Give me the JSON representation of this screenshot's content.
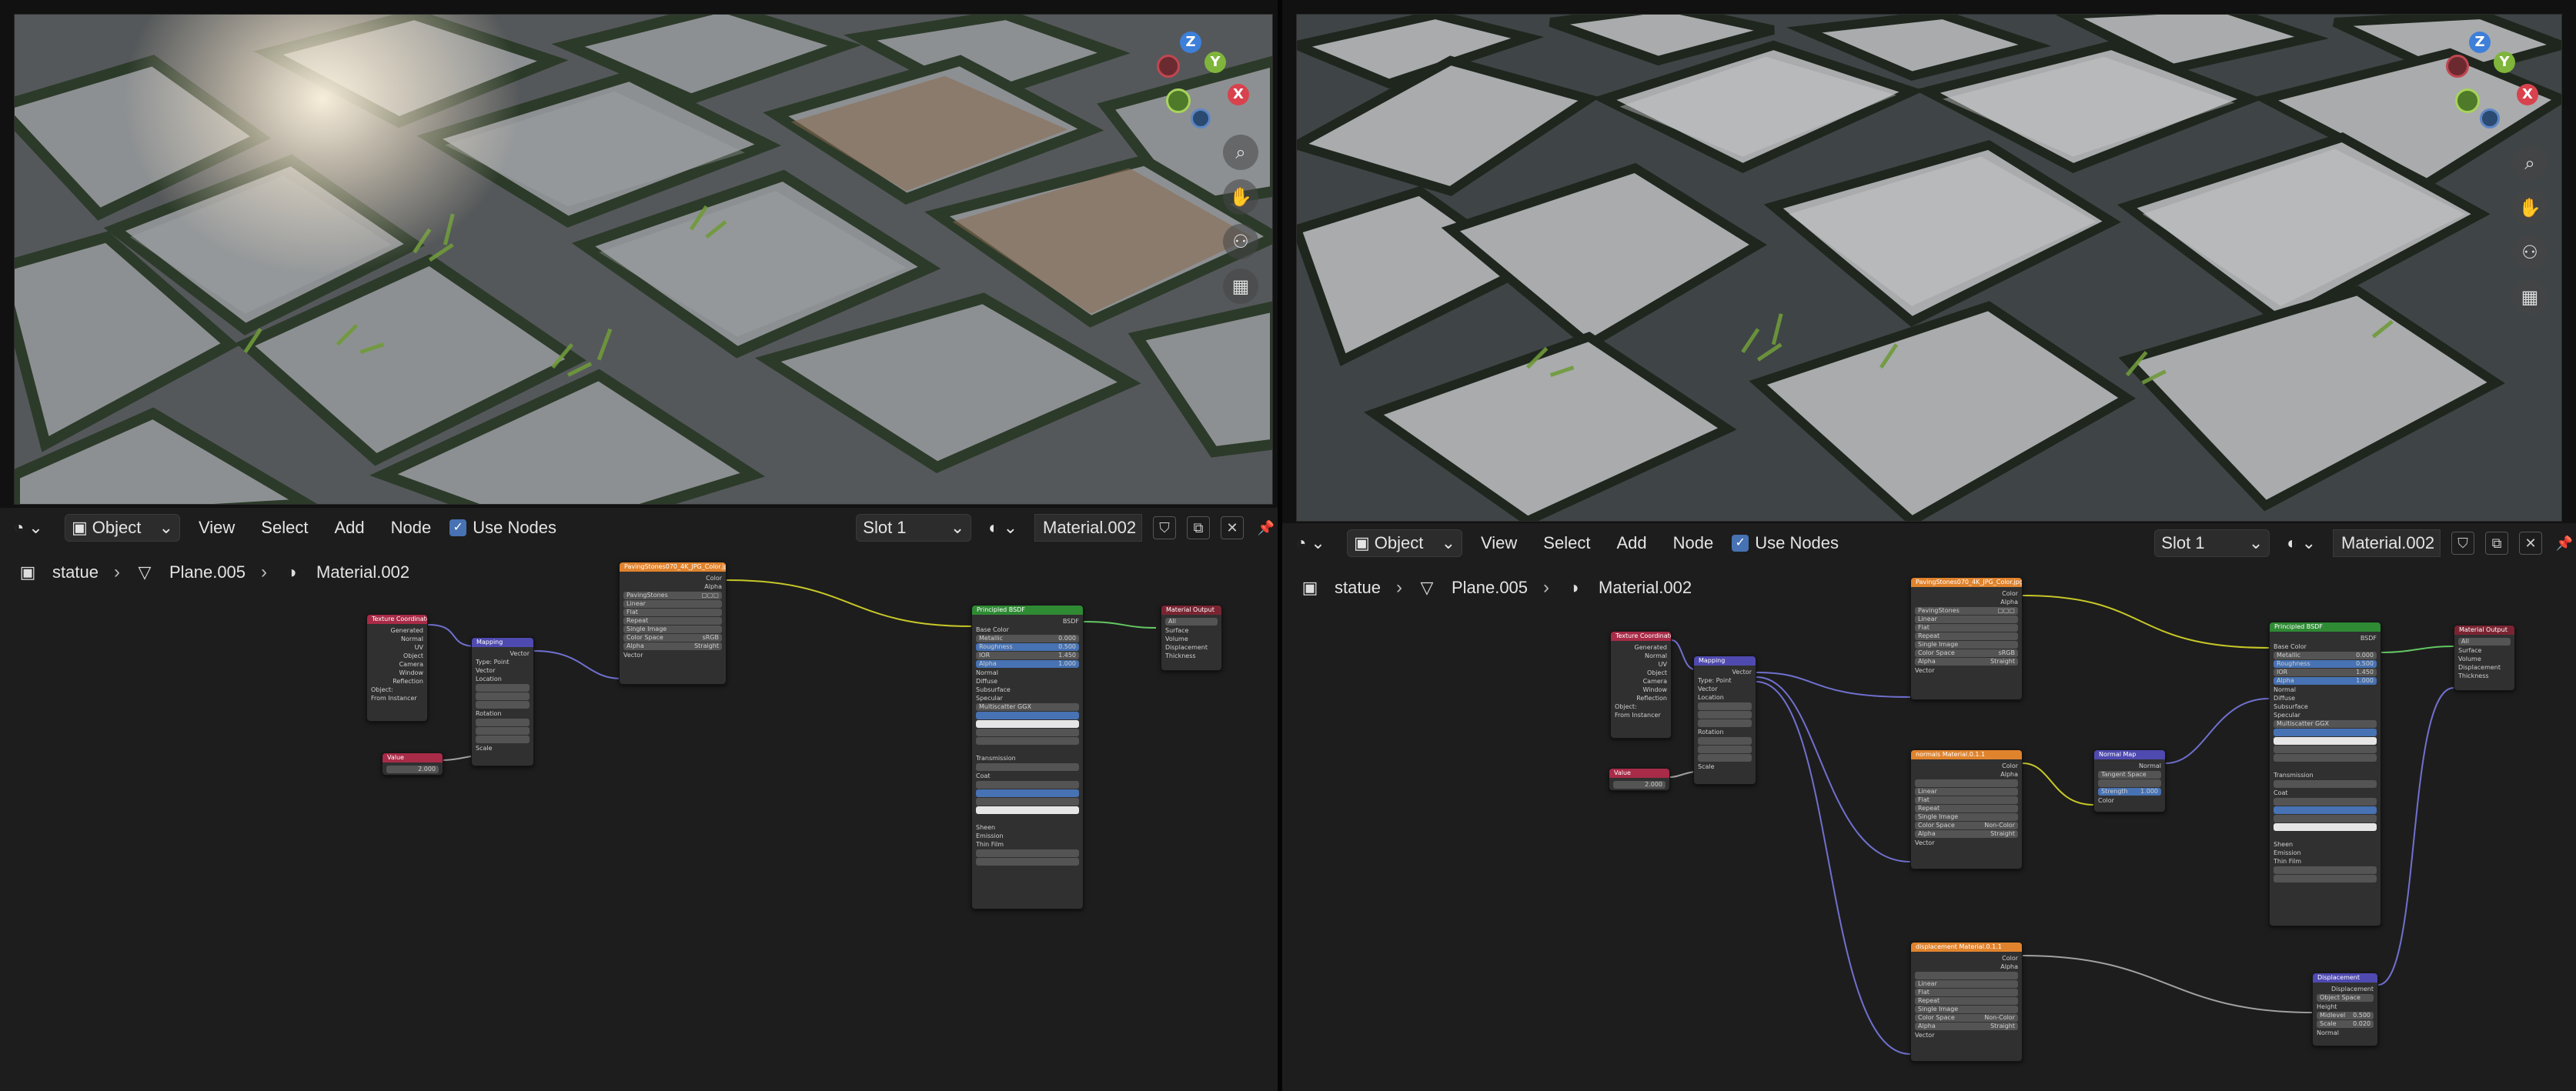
{
  "editor": {
    "mode": "Object",
    "menus": [
      "View",
      "Select",
      "Add",
      "Node"
    ],
    "use_nodes_label": "Use Nodes",
    "use_nodes_checked": true,
    "slot": "Slot 1",
    "material": "Material.002"
  },
  "breadcrumb": {
    "object": "statue",
    "mesh": "Plane.005",
    "material": "Material.002"
  },
  "left_nodes": {
    "tex_coord": {
      "title": "Texture Coordinate",
      "outputs": [
        "Generated",
        "Normal",
        "UV",
        "Object",
        "Camera",
        "Window",
        "Reflection"
      ],
      "object_label": "Object:",
      "from_instancer": "From Instancer"
    },
    "value": {
      "title": "Value",
      "value": "2.000"
    },
    "mapping": {
      "title": "Mapping",
      "output": "Vector",
      "type_label": "Type:",
      "type_value": "Point",
      "inputs": [
        "Vector",
        "Location",
        "Rotation",
        "Scale"
      ]
    },
    "image": {
      "title": "PavingStones070_4K_JPG_Color.jpg",
      "outputs": [
        "Color",
        "Alpha"
      ],
      "file": "PavingStones",
      "options": [
        "Linear",
        "Flat",
        "Repeat",
        "Single Image"
      ],
      "color_space_label": "Color Space",
      "color_space": "sRGB",
      "alpha_label": "Alpha",
      "alpha": "Straight",
      "vector": "Vector"
    },
    "bsdf": {
      "title": "Principled BSDF",
      "output": "BSDF",
      "rows": [
        "Base Color",
        "Metallic",
        "Roughness",
        "IOR",
        "Alpha",
        "Normal",
        "Diffuse",
        "Subsurface",
        "Specular",
        "Multiscatter GGX",
        "Transmission",
        "Coat",
        "Sheen",
        "Emission",
        "Thin Film"
      ],
      "values": {
        "metallic": "0.000",
        "roughness": "0.500",
        "ior": "1.450",
        "alpha": "1.000"
      }
    },
    "output": {
      "title": "Material Output",
      "target": "All",
      "inputs": [
        "Surface",
        "Volume",
        "Displacement",
        "Thickness"
      ]
    }
  },
  "right_nodes": {
    "color_tex": {
      "title": "PavingStones070_4K_JPG_Color.jpg"
    },
    "normal_tex": {
      "title": "normals Material.0.1.1",
      "color_space": "Non-Color"
    },
    "disp_tex": {
      "title": "displacement Material.0.1.1",
      "color_space": "Non-Color"
    },
    "normal_map": {
      "title": "Normal Map",
      "space": "Tangent Space",
      "strength_label": "Strength",
      "strength": "1.000",
      "inputs": [
        "Color"
      ],
      "output": "Normal"
    },
    "displacement": {
      "title": "Displacement",
      "output": "Displacement",
      "space": "Object Space",
      "inputs": [
        "Height",
        "Midlevel",
        "Scale",
        "Normal"
      ],
      "midlevel": "0.500",
      "scale": "0.020"
    }
  },
  "colors": {
    "texture_header": "#e0832d",
    "input_header": "#a82b47",
    "vector_header": "#4f4ab0",
    "shader_header": "#2f8a34",
    "output_header": "#7a2432",
    "accent": "#4772b3"
  }
}
